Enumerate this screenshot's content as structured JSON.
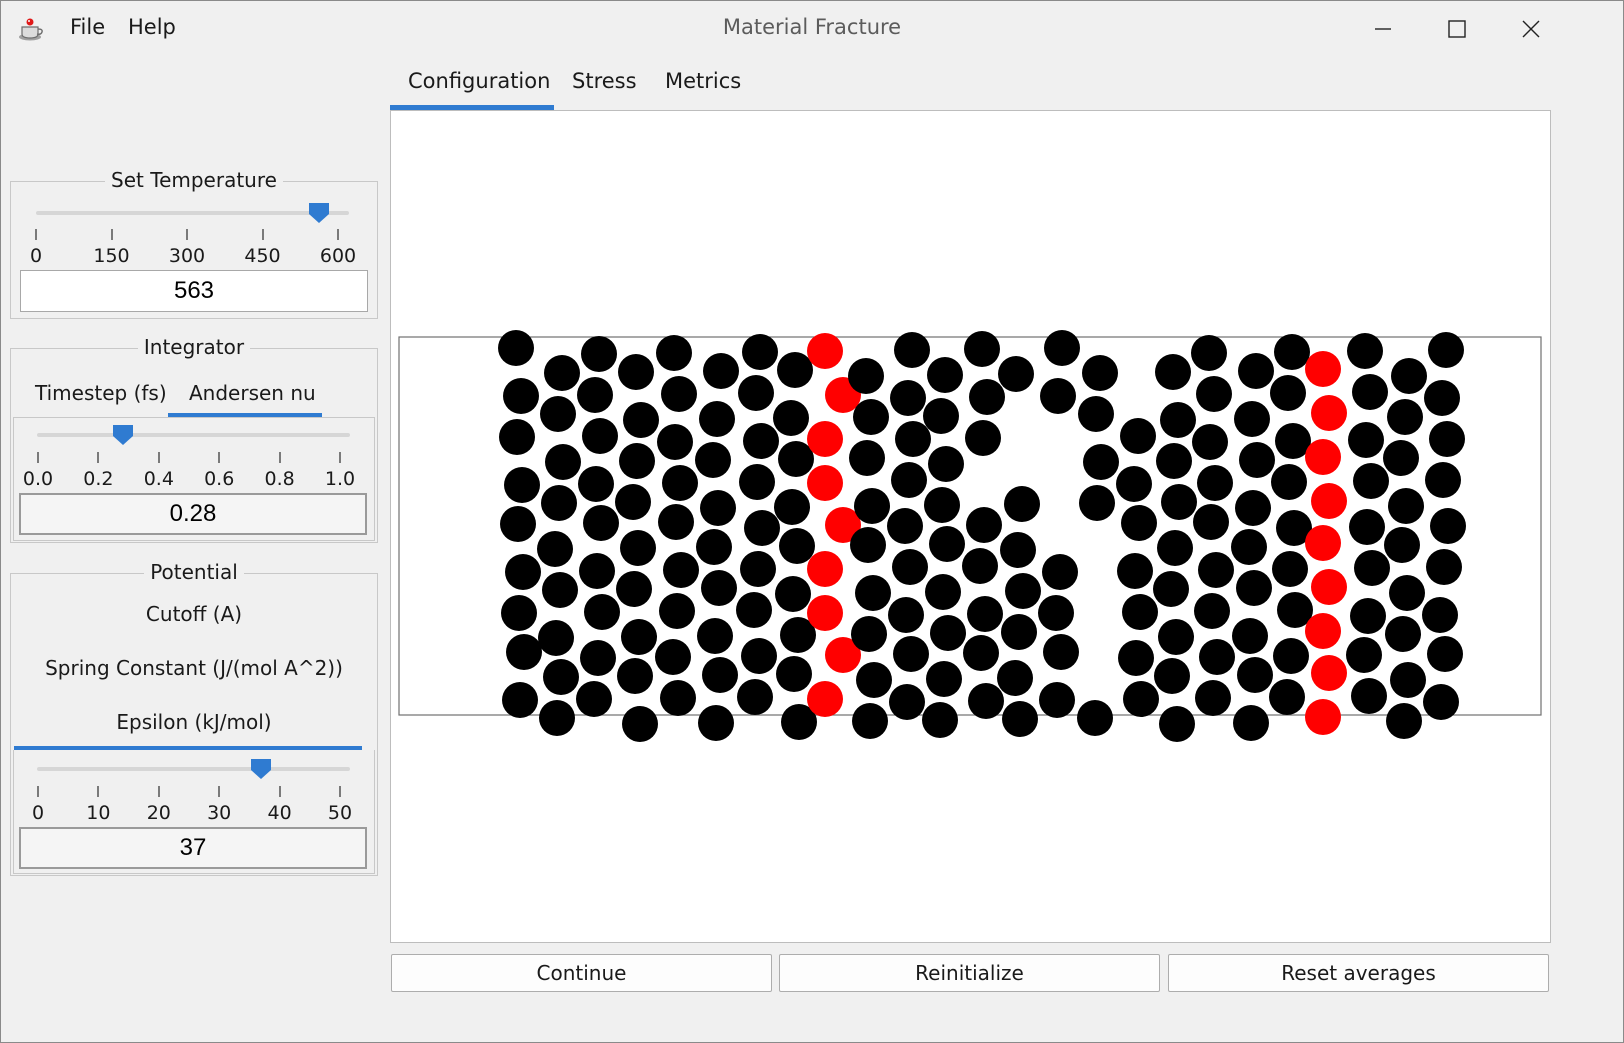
{
  "window": {
    "title": "Material Fracture"
  },
  "menu": {
    "file": "File",
    "help": "Help"
  },
  "tabs": [
    {
      "label": "Configuration",
      "active": true
    },
    {
      "label": "Stress",
      "active": false
    },
    {
      "label": "Metrics",
      "active": false
    }
  ],
  "temperature": {
    "title": "Set Temperature",
    "min": 0,
    "max": 600,
    "value": 563,
    "display_value": "563",
    "ticks": [
      "0",
      "150",
      "300",
      "450",
      "600"
    ]
  },
  "integrator": {
    "title": "Integrator",
    "subtabs": [
      {
        "label": "Timestep (fs)",
        "active": false
      },
      {
        "label": "Andersen nu",
        "active": true
      }
    ],
    "min": 0.0,
    "max": 1.0,
    "value": 0.28,
    "display_value": "0.28",
    "ticks": [
      "0.0",
      "0.2",
      "0.4",
      "0.6",
      "0.8",
      "1.0"
    ]
  },
  "potential": {
    "title": "Potential",
    "cutoff_label": "Cutoff (A)",
    "spring_label": "Spring Constant (J/(mol A^2))",
    "epsilon_label": "Epsilon (kJ/mol)",
    "min": 0,
    "max": 50,
    "value": 37,
    "display_value": "37",
    "ticks": [
      "0",
      "10",
      "20",
      "30",
      "40",
      "50"
    ]
  },
  "buttons": {
    "continue": "Continue",
    "reinitialize": "Reinitialize",
    "reset": "Reset averages"
  },
  "colors": {
    "accent": "#2f7bd1",
    "atom": "#000000",
    "marked_atom": "#ff0000"
  }
}
